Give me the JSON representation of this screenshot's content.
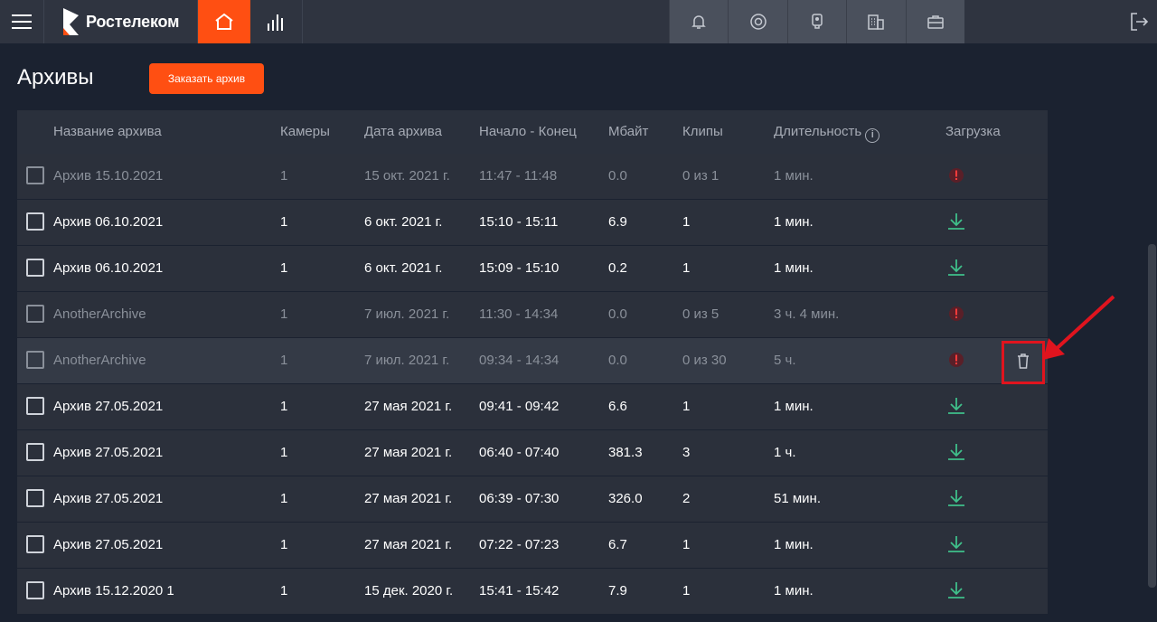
{
  "topbar": {
    "brand": "Ростелеком",
    "icons": [
      "menu-icon",
      "home-icon",
      "stats-icon",
      "bell-icon",
      "support-icon",
      "camera-icon",
      "building-icon",
      "briefcase-icon",
      "logout-icon"
    ],
    "accent": "#ff4f12"
  },
  "page": {
    "title": "Архивы",
    "order_button": "Заказать архив"
  },
  "table": {
    "headers": {
      "name": "Название архива",
      "cameras": "Камеры",
      "date": "Дата архива",
      "range": "Начало - Конец",
      "mb": "Мбайт",
      "clips": "Клипы",
      "duration": "Длительность",
      "download": "Загрузка"
    },
    "rows": [
      {
        "name": "Архив 15.10.2021",
        "cameras": "1",
        "date": "15 окт. 2021 г.",
        "range": "11:47 - 11:48",
        "mb": "0.0",
        "clips": "0 из 1",
        "duration": "1 мин.",
        "status": "error"
      },
      {
        "name": "Архив 06.10.2021",
        "cameras": "1",
        "date": "6 окт. 2021 г.",
        "range": "15:10 - 15:11",
        "mb": "6.9",
        "clips": "1",
        "duration": "1 мин.",
        "status": "ready"
      },
      {
        "name": "Архив 06.10.2021",
        "cameras": "1",
        "date": "6 окт. 2021 г.",
        "range": "15:09 - 15:10",
        "mb": "0.2",
        "clips": "1",
        "duration": "1 мин.",
        "status": "ready"
      },
      {
        "name": "AnotherArchive",
        "cameras": "1",
        "date": "7 июл. 2021 г.",
        "range": "11:30 - 14:34",
        "mb": "0.0",
        "clips": "0 из 5",
        "duration": "3 ч. 4 мин.",
        "status": "error"
      },
      {
        "name": "AnotherArchive",
        "cameras": "1",
        "date": "7 июл. 2021 г.",
        "range": "09:34 - 14:34",
        "mb": "0.0",
        "clips": "0 из 30",
        "duration": "5 ч.",
        "status": "error"
      },
      {
        "name": "Архив 27.05.2021",
        "cameras": "1",
        "date": "27 мая 2021 г.",
        "range": "09:41 - 09:42",
        "mb": "6.6",
        "clips": "1",
        "duration": "1 мин.",
        "status": "ready"
      },
      {
        "name": "Архив 27.05.2021",
        "cameras": "1",
        "date": "27 мая 2021 г.",
        "range": "06:40 - 07:40",
        "mb": "381.3",
        "clips": "3",
        "duration": "1 ч.",
        "status": "ready"
      },
      {
        "name": "Архив 27.05.2021",
        "cameras": "1",
        "date": "27 мая 2021 г.",
        "range": "06:39 - 07:30",
        "mb": "326.0",
        "clips": "2",
        "duration": "51 мин.",
        "status": "ready"
      },
      {
        "name": "Архив 27.05.2021",
        "cameras": "1",
        "date": "27 мая 2021 г.",
        "range": "07:22 - 07:23",
        "mb": "6.7",
        "clips": "1",
        "duration": "1 мин.",
        "status": "ready"
      },
      {
        "name": "Архив 15.12.2020 1",
        "cameras": "1",
        "date": "15 дек. 2020 г.",
        "range": "15:41 - 15:42",
        "mb": "7.9",
        "clips": "1",
        "duration": "1 мин.",
        "status": "ready"
      }
    ]
  }
}
